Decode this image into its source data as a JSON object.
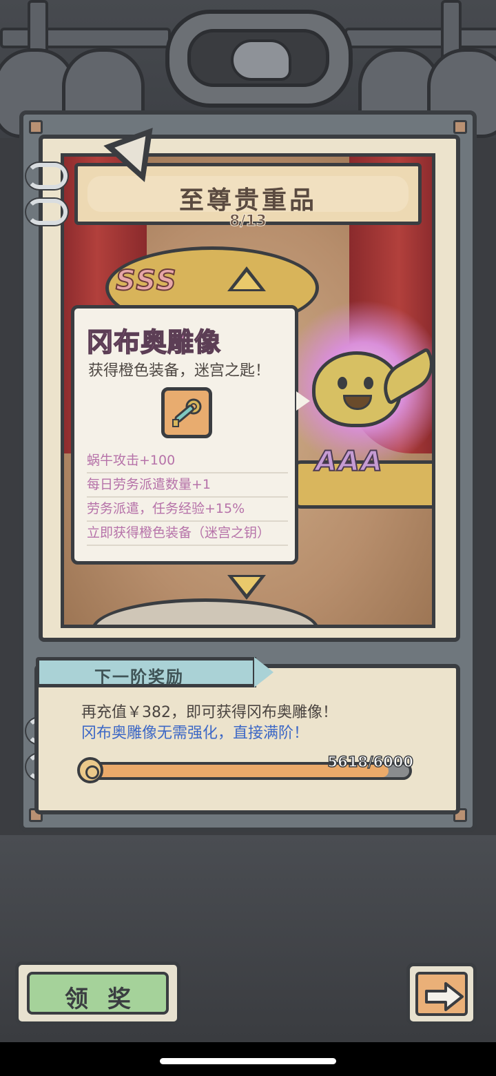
{
  "banner": {
    "title": "至尊贵重品",
    "page_counter": "8/13"
  },
  "stage": {
    "grade_top": "SSS",
    "grade_bottom": "AAA"
  },
  "item": {
    "name": "冈布奥雕像",
    "description": "获得橙色装备，迷宫之匙！",
    "icon": "maze-key-icon",
    "stats": [
      "蜗牛攻击+100",
      "每日劳务派遣数量+1",
      "劳务派遣，任务经验+15%",
      "立即获得橙色装备（迷宫之钥）"
    ]
  },
  "next_reward": {
    "tab_label": "下一阶奖励",
    "line1": "再充值￥382，即可获得冈布奥雕像！",
    "line2": "冈布奥雕像无需强化，直接满阶！",
    "progress_text": "5618/6000",
    "progress_current": 5618,
    "progress_max": 6000
  },
  "buttons": {
    "claim_label": "领奖",
    "next_icon": "arrow-right-icon"
  },
  "colors": {
    "item_name": "#d98ec2",
    "stat_text": "#b672a9",
    "highlight_line": "#3d68c6",
    "progress_fill": "#ebaa6a",
    "claim_green": "#a5d29a"
  }
}
